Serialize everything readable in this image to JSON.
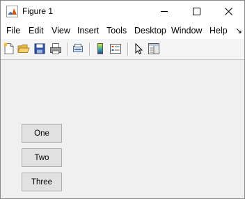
{
  "window": {
    "title": "Figure 1"
  },
  "window_controls": {
    "minimize": "minimize-icon",
    "maximize": "maximize-icon",
    "close": "close-icon"
  },
  "menubar": {
    "items": [
      "File",
      "Edit",
      "View",
      "Insert",
      "Tools",
      "Desktop",
      "Window",
      "Help"
    ],
    "overflow_icon": "double-chevron-right-icon"
  },
  "toolbar": {
    "icons": [
      "new-figure-icon",
      "open-file-icon",
      "save-icon",
      "print-icon",
      "link-plot-icon",
      "insert-colorbar-icon",
      "insert-legend-icon",
      "edit-plot-arrow-icon",
      "property-inspector-icon"
    ]
  },
  "buttons": [
    {
      "label": "One"
    },
    {
      "label": "Two"
    },
    {
      "label": "Three"
    }
  ]
}
